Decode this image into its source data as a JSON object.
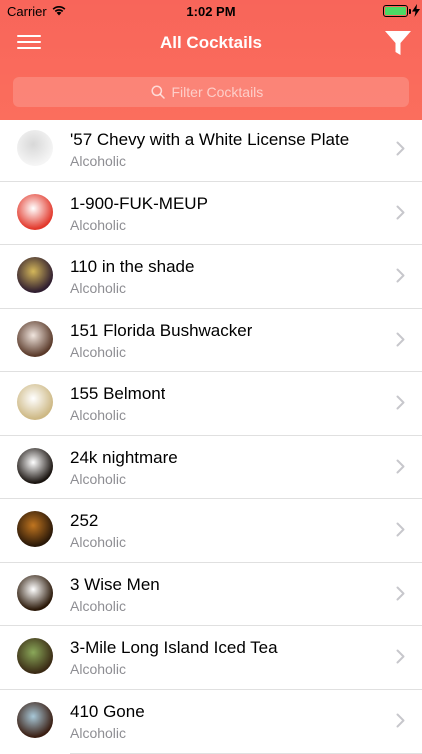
{
  "status_bar": {
    "carrier": "Carrier",
    "time": "1:02 PM",
    "battery_level": 1.0
  },
  "nav": {
    "title": "All Cocktails",
    "left_icon": "hamburger-menu-icon",
    "right_icon": "filter-funnel-icon"
  },
  "search": {
    "placeholder": "Filter Cocktails",
    "value": ""
  },
  "colors": {
    "header_accent": "#fb6a5c",
    "subtitle_gray": "#8e8e93",
    "chevron_gray": "#c7c7cc"
  },
  "cocktails": [
    {
      "name": "'57 Chevy with a White License Plate",
      "category": "Alcoholic",
      "thumb_colors": [
        "#f5f5f5",
        "#d8d8d8"
      ]
    },
    {
      "name": "1-900-FUK-MEUP",
      "category": "Alcoholic",
      "thumb_colors": [
        "#e2382b",
        "#ffffff"
      ]
    },
    {
      "name": "110 in the shade",
      "category": "Alcoholic",
      "thumb_colors": [
        "#2f1d2f",
        "#d4b75a"
      ]
    },
    {
      "name": "151 Florida Bushwacker",
      "category": "Alcoholic",
      "thumb_colors": [
        "#5a3a2a",
        "#f0e5de"
      ]
    },
    {
      "name": "155 Belmont",
      "category": "Alcoholic",
      "thumb_colors": [
        "#cdb884",
        "#ffffff"
      ]
    },
    {
      "name": "24k nightmare",
      "category": "Alcoholic",
      "thumb_colors": [
        "#1a1410",
        "#ffffff"
      ]
    },
    {
      "name": "252",
      "category": "Alcoholic",
      "thumb_colors": [
        "#2a1808",
        "#c07520"
      ]
    },
    {
      "name": "3 Wise Men",
      "category": "Alcoholic",
      "thumb_colors": [
        "#2a1808",
        "#ffffff"
      ]
    },
    {
      "name": "3-Mile Long Island Iced Tea",
      "category": "Alcoholic",
      "thumb_colors": [
        "#3a2a14",
        "#8aa85a"
      ]
    },
    {
      "name": "410 Gone",
      "category": "Alcoholic",
      "thumb_colors": [
        "#3a1e12",
        "#a8c8d8"
      ]
    }
  ]
}
